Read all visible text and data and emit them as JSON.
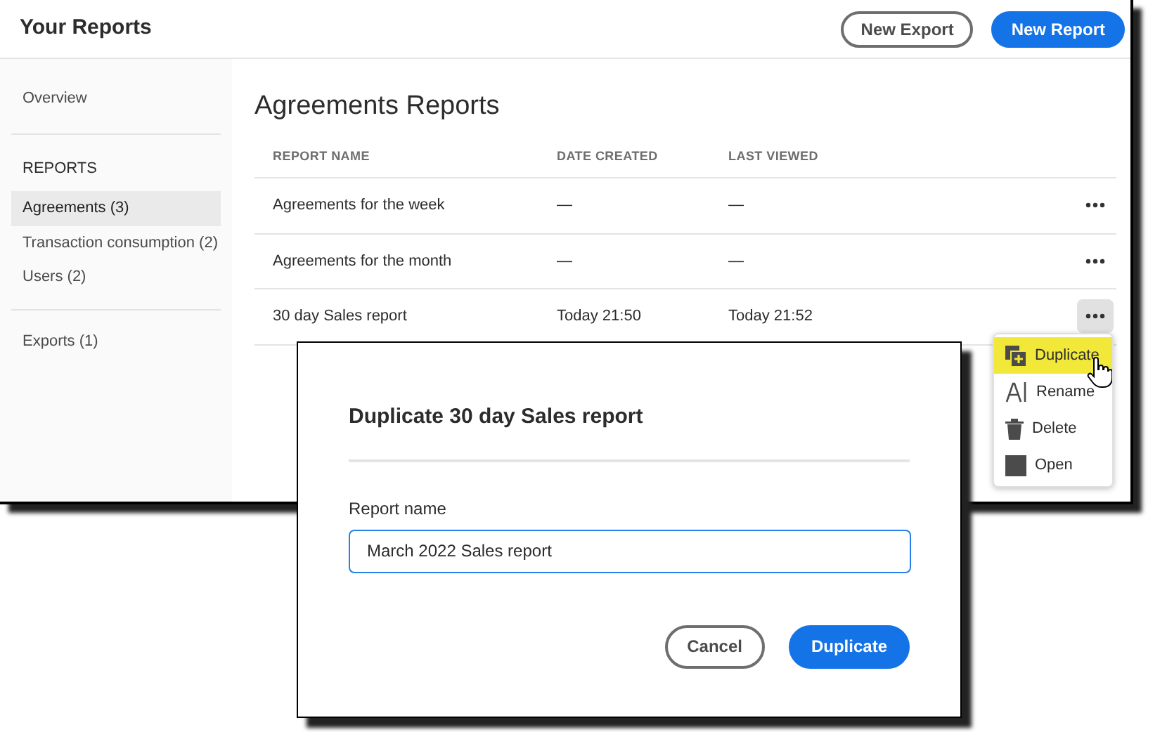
{
  "header": {
    "title": "Your Reports",
    "buttons": [
      {
        "label": "New Export",
        "kind": "secondary"
      },
      {
        "label": "New Report",
        "kind": "primary"
      }
    ]
  },
  "sidebar": {
    "overview": {
      "label": "Overview",
      "selected": false
    },
    "heading": "REPORTS",
    "items": [
      {
        "label": "Agreements (3)",
        "selected": true
      },
      {
        "label": "Transaction consumption (2)",
        "selected": false
      },
      {
        "label": "Users (2)",
        "selected": false
      }
    ],
    "exports": {
      "label": "Exports (1)",
      "selected": false
    }
  },
  "content": {
    "title": "Agreements Reports",
    "table": {
      "columns": [
        "REPORT NAME",
        "DATE CREATED",
        "LAST VIEWED"
      ],
      "rows": [
        {
          "cells": [
            "Agreements for the week",
            "—",
            "—"
          ],
          "menu_open": false
        },
        {
          "cells": [
            "Agreements for the month",
            "—",
            "—"
          ],
          "menu_open": false
        },
        {
          "cells": [
            "30 day Sales report",
            "Today 21:50",
            "Today 21:52"
          ],
          "menu_open": true
        }
      ]
    }
  },
  "menu": {
    "items": [
      {
        "label": "Duplicate",
        "kind": "duplicate",
        "selected": true
      },
      {
        "label": "Rename",
        "kind": "rename",
        "selected": false
      },
      {
        "label": "Delete",
        "kind": "delete",
        "selected": false
      },
      {
        "label": "Open",
        "kind": "open",
        "selected": false
      }
    ]
  },
  "dialog": {
    "title": "Duplicate 30 day Sales report",
    "field_label": "Report name",
    "value": "March 2022 Sales report",
    "buttons": [
      {
        "label": "Cancel",
        "kind": "secondary"
      },
      {
        "label": "Duplicate",
        "kind": "primary"
      }
    ]
  }
}
